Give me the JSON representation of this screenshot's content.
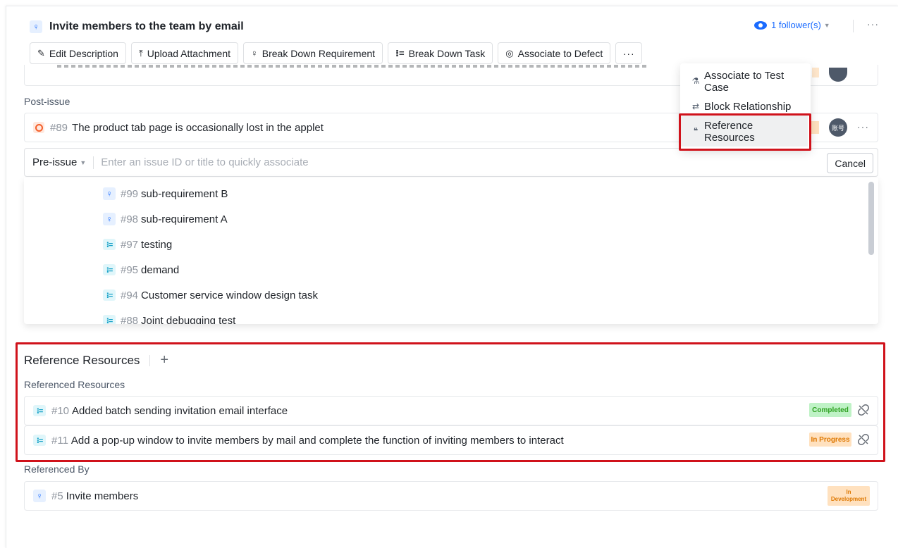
{
  "header": {
    "title": "Invite members to the team by email",
    "follower_label": "1 follower(s)",
    "more_label": "···"
  },
  "toolbar": {
    "edit_description": "Edit Description",
    "upload_attachment": "Upload Attachment",
    "break_down_requirement": "Break Down Requirement",
    "break_down_task": "Break Down Task",
    "associate_to_defect": "Associate to Defect",
    "more": "···"
  },
  "menu": {
    "items": [
      {
        "label": "Associate to Test Case",
        "line1": "Associate to Test",
        "line2": "Case",
        "icon": "flask-icon"
      },
      {
        "label": "Block Relationship",
        "icon": "block-relation-icon"
      },
      {
        "label": "Reference Resources",
        "line1": "Reference",
        "line2": "Resources",
        "icon": "quote-icon"
      }
    ]
  },
  "post_issue": {
    "label": "Post-issue",
    "items": [
      {
        "id": "#89",
        "title": "The product tab page is occasionally lost in the applet",
        "avatar": "账号",
        "more": "···"
      }
    ]
  },
  "pre_issue": {
    "type_select": "Pre-issue",
    "placeholder": "Enter an issue ID or title to quickly associate",
    "cancel": "Cancel"
  },
  "dropdown": {
    "items": [
      {
        "type": "requirement",
        "id": "#99",
        "title": "sub-requirement B"
      },
      {
        "type": "requirement",
        "id": "#98",
        "title": "sub-requirement A"
      },
      {
        "type": "task",
        "id": "#97",
        "title": "testing"
      },
      {
        "type": "task",
        "id": "#95",
        "title": "demand"
      },
      {
        "type": "task",
        "id": "#94",
        "title": "Customer service window design task"
      },
      {
        "type": "task",
        "id": "#88",
        "title": "Joint debugging test"
      }
    ]
  },
  "reference_resources": {
    "title": "Reference Resources",
    "add": "+",
    "referenced_label": "Referenced Resources",
    "referenced": [
      {
        "id": "#10",
        "title": "Added batch sending invitation email interface",
        "status": "Completed"
      },
      {
        "id": "#11",
        "title": "Add a pop-up window to invite members by mail and complete the function of inviting members to interact",
        "status": "In Progress"
      }
    ],
    "referenced_by_label": "Referenced By",
    "referenced_by": [
      {
        "id": "#5",
        "title": "Invite members",
        "status_line1": "In",
        "status_line2": "Development"
      }
    ]
  },
  "colors": {
    "accent": "#1a6bff",
    "highlight_box": "#d0121b",
    "completed_bg": "#bff2c6",
    "in_progress_bg": "#ffe1bf"
  }
}
